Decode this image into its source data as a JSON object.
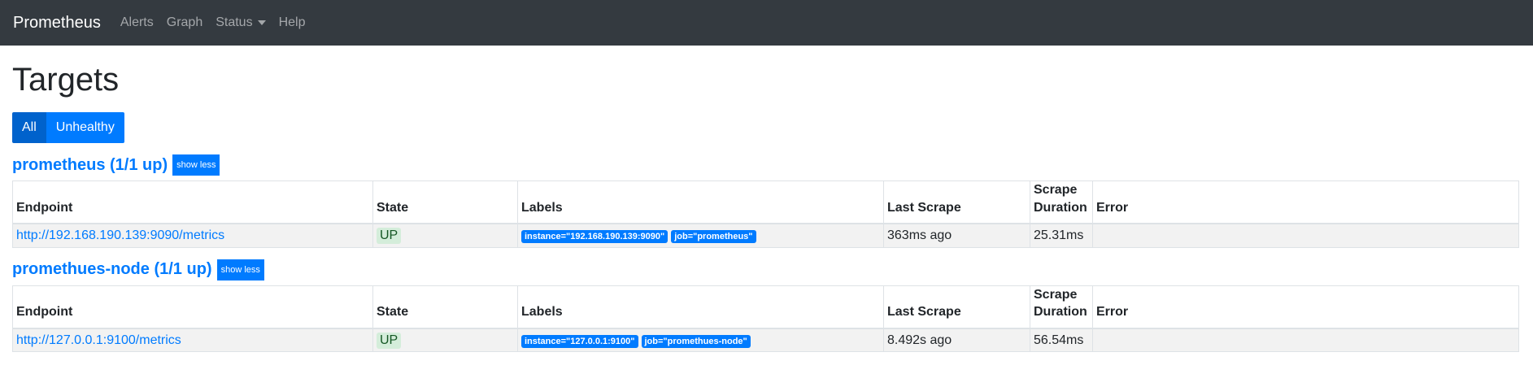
{
  "navbar": {
    "brand": "Prometheus",
    "links": [
      "Alerts",
      "Graph",
      "Status",
      "Help"
    ]
  },
  "page": {
    "title": "Targets",
    "filters": {
      "all": "All",
      "unhealthy": "Unhealthy",
      "active": "All"
    }
  },
  "table_headers": {
    "endpoint": "Endpoint",
    "state": "State",
    "labels": "Labels",
    "last_scrape": "Last Scrape",
    "scrape_duration": "Scrape Duration",
    "error": "Error"
  },
  "pools": [
    {
      "title": "prometheus (1/1 up)",
      "toggle": "show less",
      "targets": [
        {
          "endpoint": "http://192.168.190.139:9090/metrics",
          "state": "UP",
          "labels": [
            "instance=\"192.168.190.139:9090\"",
            "job=\"prometheus\""
          ],
          "last_scrape": "363ms ago",
          "duration": "25.31ms",
          "error": ""
        }
      ]
    },
    {
      "title": "promethues-node (1/1 up)",
      "toggle": "show less",
      "targets": [
        {
          "endpoint": "http://127.0.0.1:9100/metrics",
          "state": "UP",
          "labels": [
            "instance=\"127.0.0.1:9100\"",
            "job=\"promethues-node\""
          ],
          "last_scrape": "8.492s ago",
          "duration": "56.54ms",
          "error": ""
        }
      ]
    }
  ],
  "colors": {
    "navbar_bg": "#343a40",
    "primary": "#007bff",
    "up_badge_bg": "#d4edda",
    "up_badge_text": "#155724"
  }
}
